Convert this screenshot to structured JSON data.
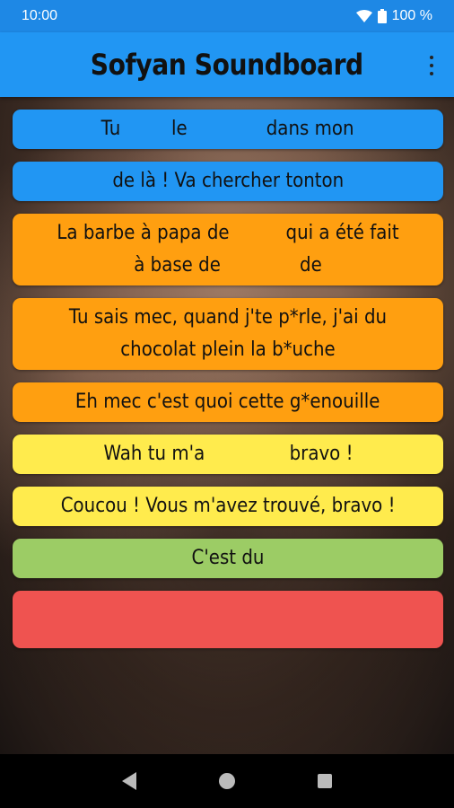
{
  "status": {
    "time": "10:00",
    "battery": "100 %"
  },
  "app": {
    "title": "Sofyan Soundboard"
  },
  "colors": {
    "blue": "#2196f3",
    "orange": "#ff9f10",
    "yellow": "#ffeb4d",
    "green": "#9ccc65",
    "red": "#ef5350"
  },
  "sounds": [
    {
      "text": "Tu         le              dans mon",
      "color": "#2196f3"
    },
    {
      "text": "de là ! Va chercher tonton",
      "color": "#2196f3"
    },
    {
      "text": "La barbe à papa de          qui a été fait à base de              de",
      "color": "#ff9f10"
    },
    {
      "text": "Tu sais mec, quand j'te p*rle, j'ai du chocolat plein la b*uche",
      "color": "#ff9f10"
    },
    {
      "text": "Eh mec c'est quoi cette g*enouille",
      "color": "#ff9f10"
    },
    {
      "text": "Wah tu m'a               bravo !",
      "color": "#ffeb4d"
    },
    {
      "text": "Coucou ! Vous m'avez trouvé, bravo !",
      "color": "#ffeb4d"
    },
    {
      "text": "C'est du",
      "color": "#9ccc65"
    },
    {
      "text": "",
      "color": "#ef5350"
    }
  ]
}
